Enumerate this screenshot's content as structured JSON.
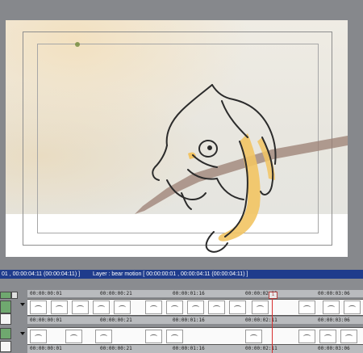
{
  "status_bar": {
    "range": "01 , 00:00:04:11  (00:00:04:11) ]",
    "layer": "Layer : bear motion [ 00:00:00:01 , 00:00:04:11  (00:00:04:11) ]"
  },
  "timeline": {
    "ruler_labels": [
      "00:00:00:01",
      "00:00:00:21",
      "00:00:01:16",
      "00:00:02:11",
      "00:00:03:06"
    ],
    "playhead_marker": "1",
    "icons": [
      "collapse-icon",
      "arrow-down-icon",
      "check-icon"
    ]
  }
}
